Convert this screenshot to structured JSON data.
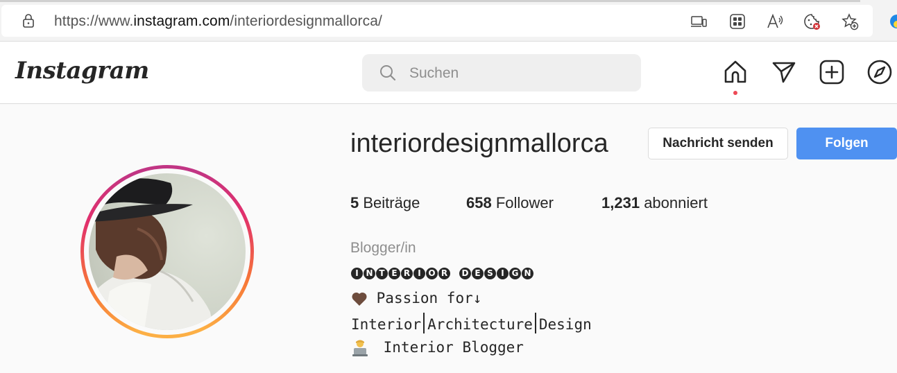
{
  "browser": {
    "url_prefix": "https://www.",
    "url_domain": "instagram.com",
    "url_path": "/interiordesignmallorca/"
  },
  "instagram": {
    "logo_text": "Instagram",
    "search_placeholder": "Suchen",
    "nav_icons": [
      "home-icon",
      "direct-message-icon",
      "new-post-icon",
      "explore-icon"
    ],
    "notification_dot_color": "#ed4956"
  },
  "profile": {
    "username": "interiordesignmallorca",
    "message_button_label": "Nachricht senden",
    "follow_button_label": "Folgen",
    "follow_button_color": "#4f91f1",
    "stats": {
      "posts_count": "5",
      "posts_label": "Beiträge",
      "followers_count": "658",
      "followers_label": "Follower",
      "following_count": "1,231",
      "following_label": "abonniert"
    },
    "category": "Blogger/in",
    "bio": {
      "headline_word1": [
        "I",
        "N",
        "T",
        "E",
        "R",
        "I",
        "O",
        "R"
      ],
      "headline_word2": [
        "D",
        "E",
        "S",
        "I",
        "G",
        "N"
      ],
      "passion_line": "Passion for↓",
      "topic_1": "Interior",
      "topic_2": "Architecture",
      "topic_3": "Design",
      "blogger_line": "Interior Blogger"
    }
  }
}
